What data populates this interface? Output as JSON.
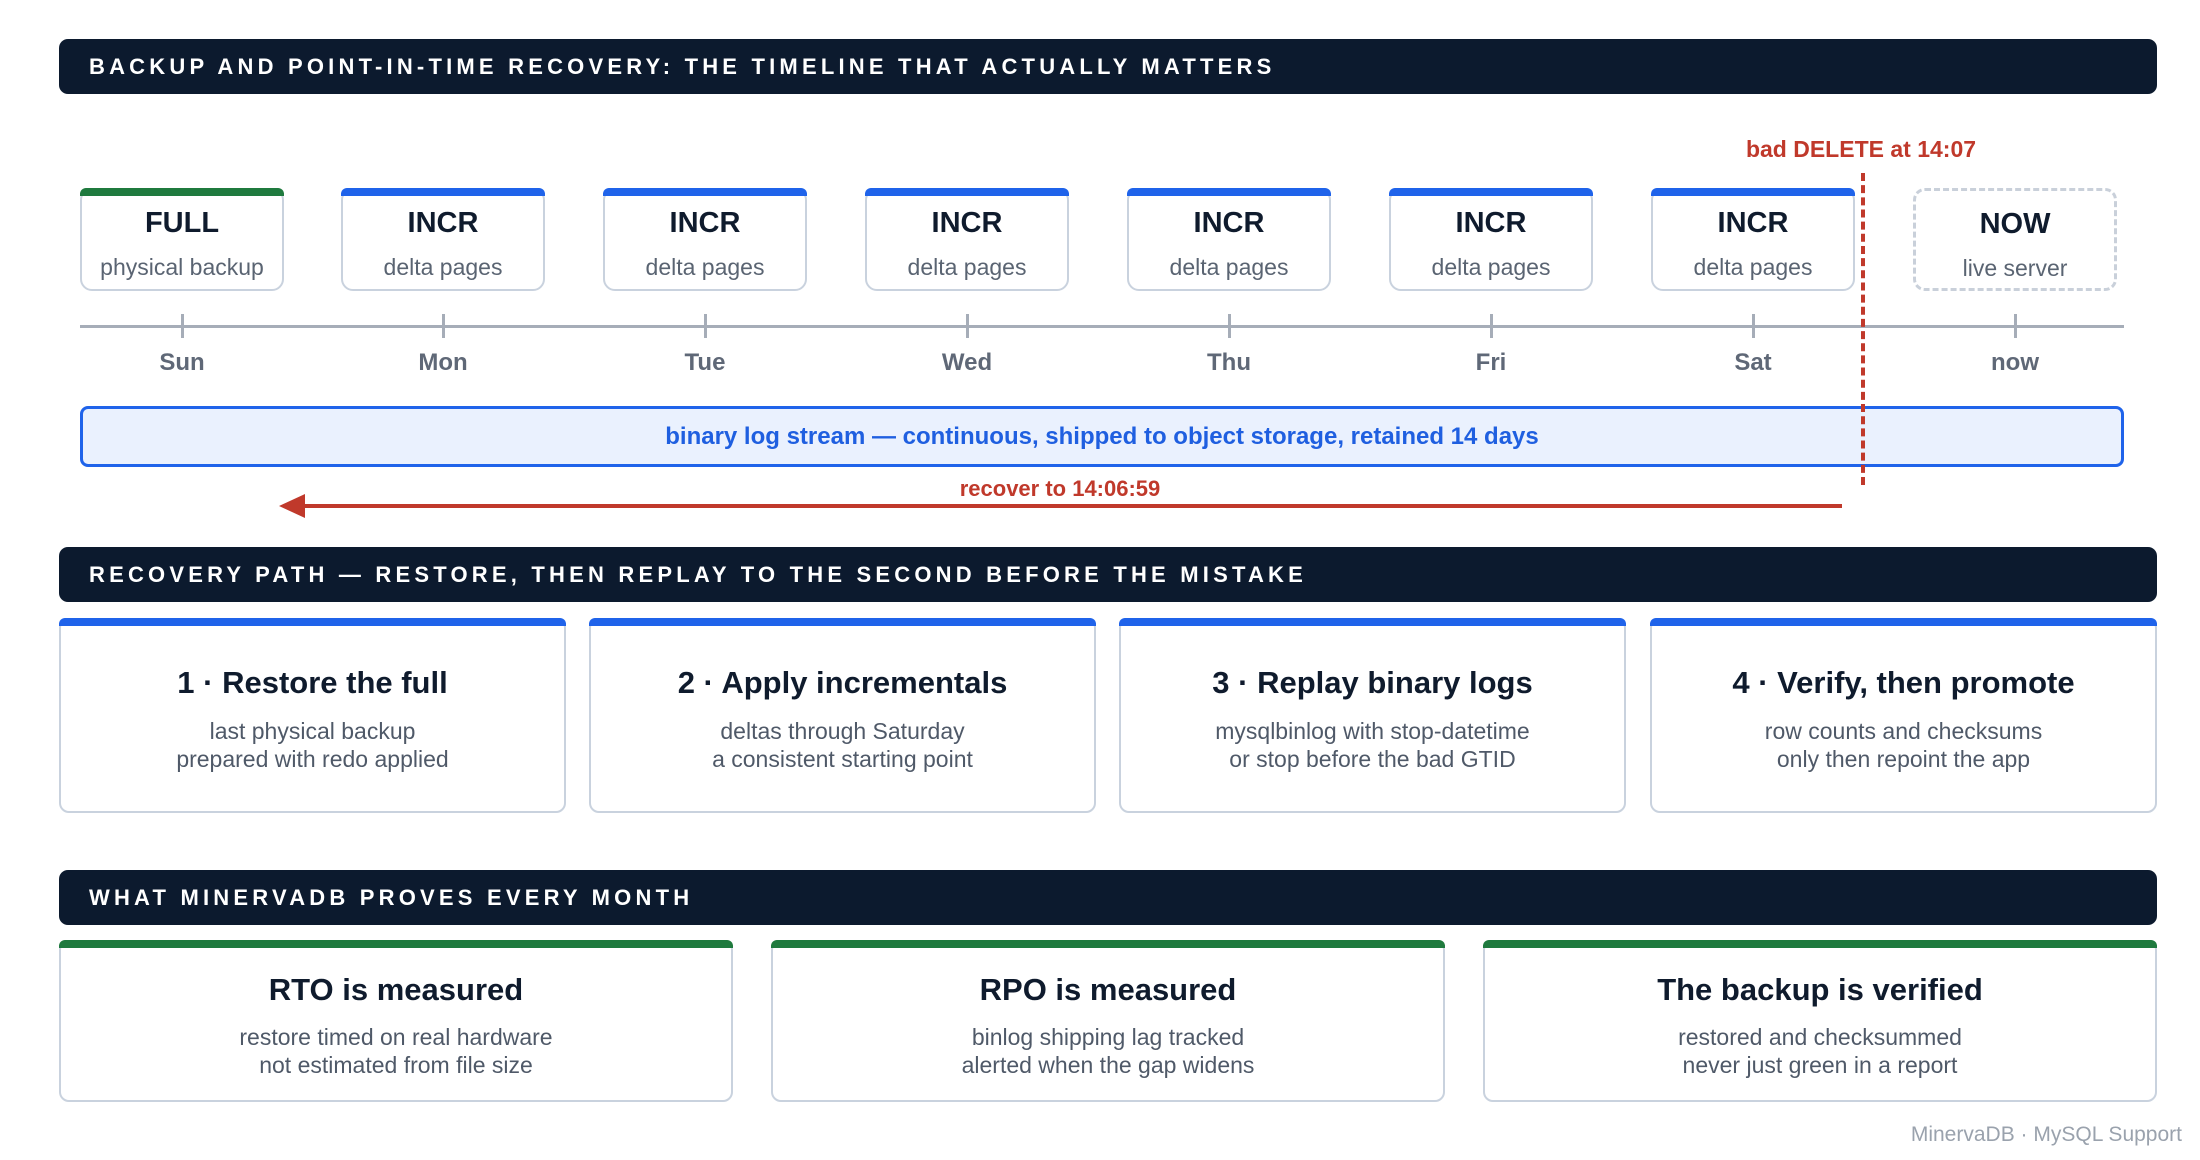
{
  "colors": {
    "banner_bg": "#0c1a2e",
    "full_accent": "#1f7a3e",
    "incr_accent": "#1f63ea",
    "danger": "#c0392b",
    "stream_bg": "#eaf1fe"
  },
  "section1": {
    "title": "BACKUP AND POINT-IN-TIME RECOVERY: THE TIMELINE THAT ACTUALLY MATTERS"
  },
  "timeline": {
    "boxes": [
      {
        "title": "FULL",
        "sub": "physical backup",
        "accent": "green"
      },
      {
        "title": "INCR",
        "sub": "delta pages",
        "accent": "blue"
      },
      {
        "title": "INCR",
        "sub": "delta pages",
        "accent": "blue"
      },
      {
        "title": "INCR",
        "sub": "delta pages",
        "accent": "blue"
      },
      {
        "title": "INCR",
        "sub": "delta pages",
        "accent": "blue"
      },
      {
        "title": "INCR",
        "sub": "delta pages",
        "accent": "blue"
      },
      {
        "title": "INCR",
        "sub": "delta pages",
        "accent": "blue"
      },
      {
        "title": "NOW",
        "sub": "live server",
        "accent": "dashed"
      }
    ],
    "days": [
      "Sun",
      "Mon",
      "Tue",
      "Wed",
      "Thu",
      "Fri",
      "Sat",
      "now"
    ],
    "stream_label": "binary log stream — continuous, shipped to object storage, retained 14 days",
    "bad_event": "bad DELETE at 14:07",
    "recover_label": "recover to 14:06:59"
  },
  "section2": {
    "title": "RECOVERY PATH — RESTORE, THEN REPLAY TO THE SECOND BEFORE THE MISTAKE"
  },
  "steps": [
    {
      "title": "1 · Restore the full",
      "l1": "last physical backup",
      "l2": "prepared with redo applied"
    },
    {
      "title": "2 · Apply incrementals",
      "l1": "deltas through Saturday",
      "l2": "a consistent starting point"
    },
    {
      "title": "3 · Replay binary logs",
      "l1": "mysqlbinlog with stop-datetime",
      "l2": "or stop before the bad GTID"
    },
    {
      "title": "4 · Verify, then promote",
      "l1": "row counts and checksums",
      "l2": "only then repoint the app"
    }
  ],
  "section3": {
    "title": "WHAT MINERVADB PROVES EVERY MONTH"
  },
  "proofs": [
    {
      "title": "RTO is measured",
      "l1": "restore timed on real hardware",
      "l2": "not estimated from file size"
    },
    {
      "title": "RPO is measured",
      "l1": "binlog shipping lag tracked",
      "l2": "alerted when the gap widens"
    },
    {
      "title": "The backup is verified",
      "l1": "restored and checksummed",
      "l2": "never just green in a report"
    }
  ],
  "footer": "MinervaDB · MySQL Support"
}
